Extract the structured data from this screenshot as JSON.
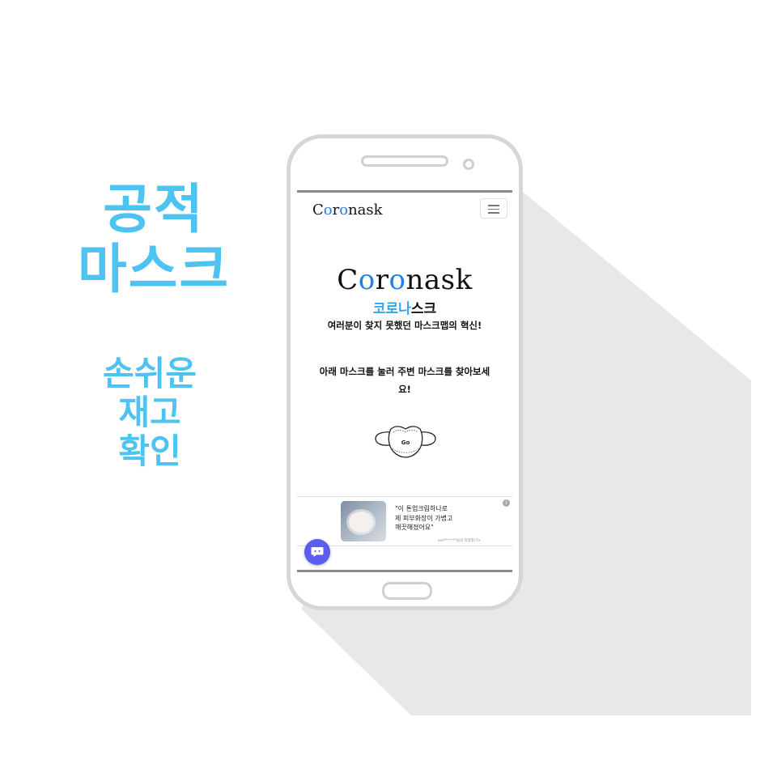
{
  "promo": {
    "title_line1": "공적",
    "title_line2": "마스크",
    "sub_line1": "손쉬운",
    "sub_line2": "재고",
    "sub_line3": "확인"
  },
  "navbar": {
    "logo": {
      "c": "C",
      "o1": "o",
      "r": "r",
      "o2": "o",
      "rest": "nask"
    },
    "menu_icon": "hamburger-icon"
  },
  "hero": {
    "logo": {
      "c": "C",
      "o1": "o",
      "r": "r",
      "o2": "o",
      "rest": "nask"
    },
    "subtitle_blue": "코로나",
    "subtitle_dark": "스크",
    "description1": "여러분이 찾지 못했던 마스크맵의 혁신!",
    "description2": "아래 마스크를 눌러 주변 마스크를 찾아보세요!",
    "mask_icon": "face-mask-icon",
    "mask_label": "Go"
  },
  "ad": {
    "line1": "\"이 톤업크림하나로",
    "line2": "제 피부화장이 가볍고",
    "line3": "깨끗해졌어요\"",
    "note": "sss*******님의 리얼후기>",
    "info_symbol": "i"
  },
  "chat": {
    "icon": "chat-bubble-icon"
  },
  "colors": {
    "promo": "#4dc3f2",
    "brand_blue": "#2a7de1",
    "subtitle_blue": "#2aa8f0",
    "chat_button": "#5b5ef0"
  }
}
